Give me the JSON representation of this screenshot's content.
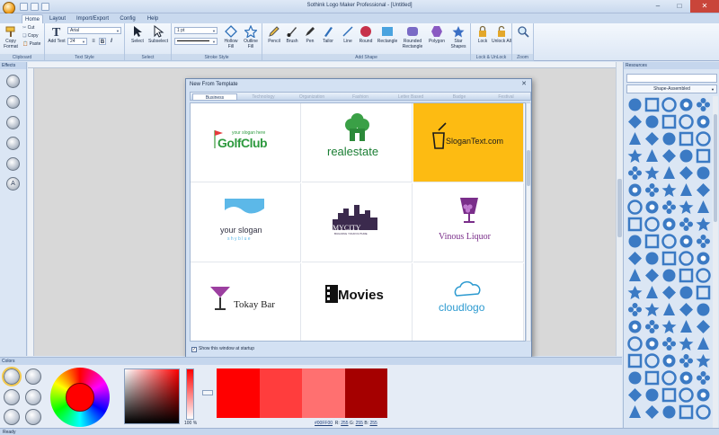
{
  "window": {
    "title": "Sothink Logo Maker Professional - [Untitled]"
  },
  "ribbon": {
    "tabs": [
      "Home",
      "Layout",
      "Import/Export",
      "Config",
      "Help"
    ],
    "clipboard": {
      "copy_format": "Copy Format",
      "cut": "Cut",
      "copy": "Copy",
      "paste": "Paste",
      "label": "Clipboard"
    },
    "text_style": {
      "add_text": "Add Text",
      "font": "Arial",
      "size": "24",
      "label": "Text Style"
    },
    "select": {
      "select": "Select",
      "subselect": "Subselect",
      "label": "Select"
    },
    "stroke_style": {
      "width": "1 pt",
      "hollow_fill": "Hollow Fill",
      "outline_fill": "Outline Fill",
      "label": "Stroke Style"
    },
    "add_shape": {
      "items": [
        "Pencil",
        "Brush",
        "Pen",
        "Tailor",
        "Line",
        "Round",
        "Rectangle",
        "Rounded Rectangle",
        "Polygon",
        "Star Shapes"
      ],
      "label": "Add Shape"
    },
    "lock": {
      "lock": "Lock",
      "unlock_all": "Unlock All",
      "label": "Lock & UnLock"
    },
    "zoom": {
      "label": "Zoom"
    }
  },
  "effects": {
    "title": "Effects"
  },
  "dialog": {
    "title": "New From Template",
    "categories": [
      "Business",
      "Technology",
      "Organization",
      "Fashion",
      "Letter Based",
      "Badge",
      "Festival"
    ],
    "active_category": "Business",
    "templates": [
      {
        "line1": "your slogan here",
        "line2": "GolfClub"
      },
      {
        "line1": "realestate"
      },
      {
        "line1": "SloganText.com"
      },
      {
        "line1": "your slogan",
        "line2": "s h y   b l u e"
      },
      {
        "line1": "MYCITY",
        "line2": "BUILDING YOUR FUTURE"
      },
      {
        "line1": "Vinous Liquor"
      },
      {
        "line1": "Tokay Bar"
      },
      {
        "line1": "Movies"
      },
      {
        "line1": "cloudlogo"
      }
    ],
    "show_at_startup": "Show this window at startup"
  },
  "resources": {
    "title": "Resources",
    "category": "Shape-Assembled"
  },
  "colors": {
    "title": "Colors",
    "alpha": "100 %",
    "swatches": [
      "#ff0000",
      "#ff3d3d",
      "#ff7070",
      "#a50000"
    ],
    "hex": "#00FF00",
    "r_label": "R:",
    "r": "255",
    "g_label": "G:",
    "g": "255",
    "b_label": "B:",
    "b": "255"
  },
  "status": {
    "text": "Ready"
  },
  "colors_palette": {
    "accent": "#f5c21b",
    "shape_blue": "#3b7ac4",
    "brand_red": "#ff0000"
  }
}
